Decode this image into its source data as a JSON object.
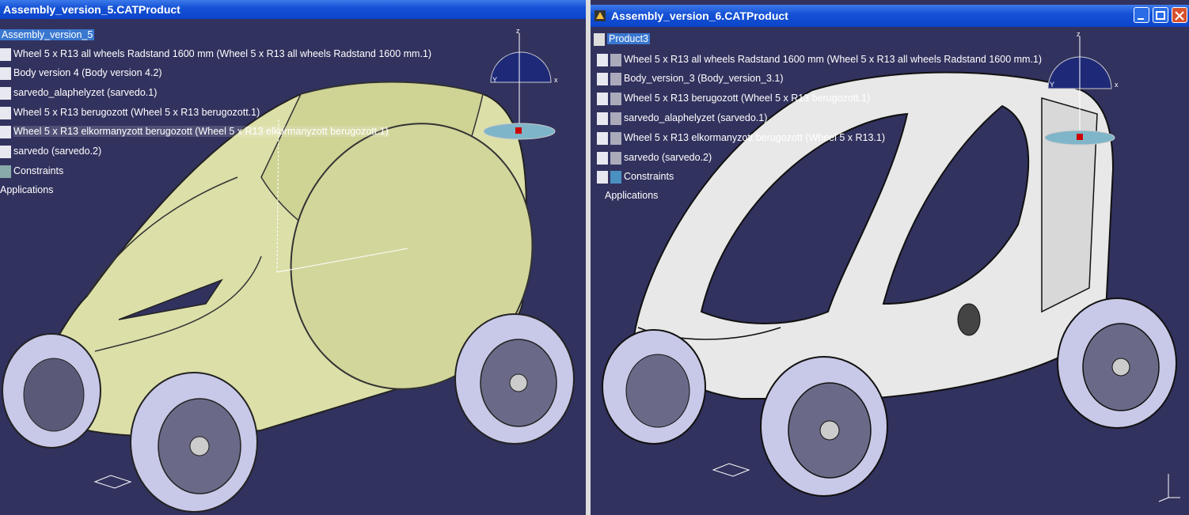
{
  "left_window": {
    "title": "Assembly_version_5.CATProduct",
    "tree": {
      "root": "Assembly_version_5",
      "items": [
        "Wheel 5 x R13 all wheels Radstand 1600 mm (Wheel 5 x R13 all wheels Radstand 1600 mm.1)",
        "Body version 4 (Body version 4.2)",
        "sarvedo_alaphelyzet (sarvedo.1)",
        "Wheel 5 x R13 berugozott (Wheel 5 x R13 berugozott.1)",
        "Wheel 5 x R13 elkormanyzott berugozott (Wheel 5 x R13 elkormanyzott berugozott.1)",
        "sarvedo (sarvedo.2)",
        "Constraints",
        "Applications"
      ]
    },
    "compass": {
      "z": "z",
      "y": "Y",
      "x": "x"
    }
  },
  "right_window": {
    "title": "Assembly_version_6.CATProduct",
    "tree": {
      "root": "Product3",
      "items": [
        "Wheel 5 x R13 all wheels Radstand 1600 mm (Wheel 5 x R13 all wheels Radstand 1600 mm.1)",
        "Body_version_3 (Body_version_3.1)",
        "Wheel 5 x R13 berugozott (Wheel 5 x R13 berugozott.1)",
        "sarvedo_alaphelyzet (sarvedo.1)",
        "Wheel 5 x R13 elkormanyzott berugozott (Wheel 5 x R13.1)",
        "sarvedo (sarvedo.2)",
        "Constraints",
        "Applications"
      ]
    },
    "compass": {
      "z": "z",
      "y": "Y",
      "x": "x"
    }
  },
  "colors": {
    "viewport_bg": "#32325f",
    "body_yellow": "#dcdfa8",
    "body_white": "#e8e8e8",
    "tire": "#c8c8e8",
    "titlebar": "#0b44c9"
  }
}
